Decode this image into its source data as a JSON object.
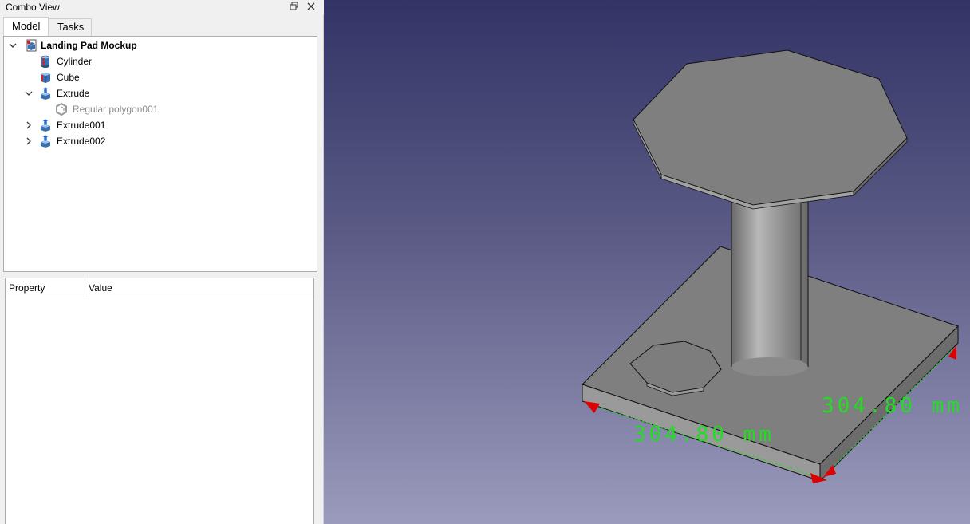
{
  "combo_view": {
    "title": "Combo View",
    "tabs": [
      {
        "label": "Model",
        "active": true
      },
      {
        "label": "Tasks",
        "active": false
      }
    ]
  },
  "tree": {
    "root": {
      "label": "Landing Pad Mockup",
      "icon": "document-icon",
      "expanded": true
    },
    "items": [
      {
        "label": "Cylinder",
        "icon": "cylinder-icon"
      },
      {
        "label": "Cube",
        "icon": "cube-icon"
      },
      {
        "label": "Extrude",
        "icon": "extrude-icon",
        "expanded": true
      },
      {
        "label": "Regular polygon001",
        "icon": "polygon-icon",
        "hidden": true
      },
      {
        "label": "Extrude001",
        "icon": "extrude-icon",
        "expanded": false
      },
      {
        "label": "Extrude002",
        "icon": "extrude-icon",
        "expanded": false
      }
    ]
  },
  "properties": {
    "col_property": "Property",
    "col_value": "Value"
  },
  "viewport": {
    "dimension_front": "304.80 mm",
    "dimension_side": "304.80 mm",
    "colors": {
      "background_top": "#333366",
      "background_bottom": "#9b9bbd",
      "dimension": "#22dd22",
      "arrow": "#dd0000"
    }
  }
}
